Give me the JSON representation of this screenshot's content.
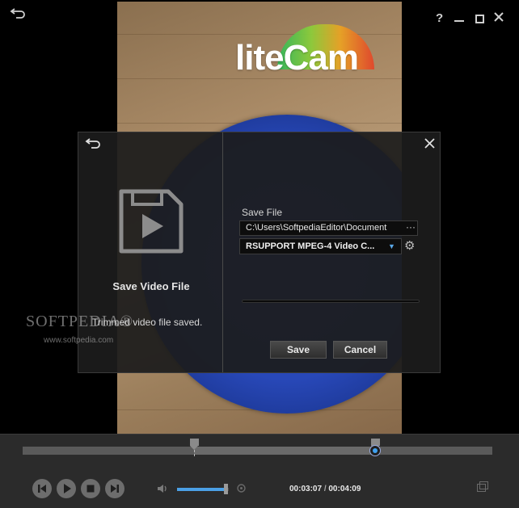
{
  "window": {
    "back_icon": "back-arrow-icon",
    "help_label": "?",
    "minimize_icon": "minimize-icon",
    "maximize_icon": "maximize-icon",
    "close_icon": "close-icon"
  },
  "video": {
    "logo_text": "liteCam"
  },
  "dialog": {
    "title": "Save Video File",
    "message": "Trimmed video file saved.",
    "save_file_label": "Save File",
    "path_value": "C:\\Users\\SoftpediaEditor\\Document",
    "path_more": "···",
    "codec_value": "RSUPPORT MPEG-4 Video C...",
    "save_button": "Save",
    "cancel_button": "Cancel",
    "icon": "save-video-file-icon",
    "progress": 0
  },
  "watermark": {
    "brand": "SOFTPEDIA®",
    "url": "www.softpedia.com"
  },
  "player": {
    "current_time": "00:03:07",
    "separator": "/",
    "total_time": "00:04:09",
    "trim_start_fraction": 0.365,
    "trim_end_fraction": 0.751,
    "playhead_fraction": 0.751,
    "volume_fraction": 0.95,
    "controls": [
      "previous-icon",
      "play-icon",
      "stop-icon",
      "next-icon"
    ]
  },
  "colors": {
    "accent": "#3fa0f0",
    "dialog_bg": "#1c1c1c",
    "bar_bg": "#2b2b2b"
  }
}
